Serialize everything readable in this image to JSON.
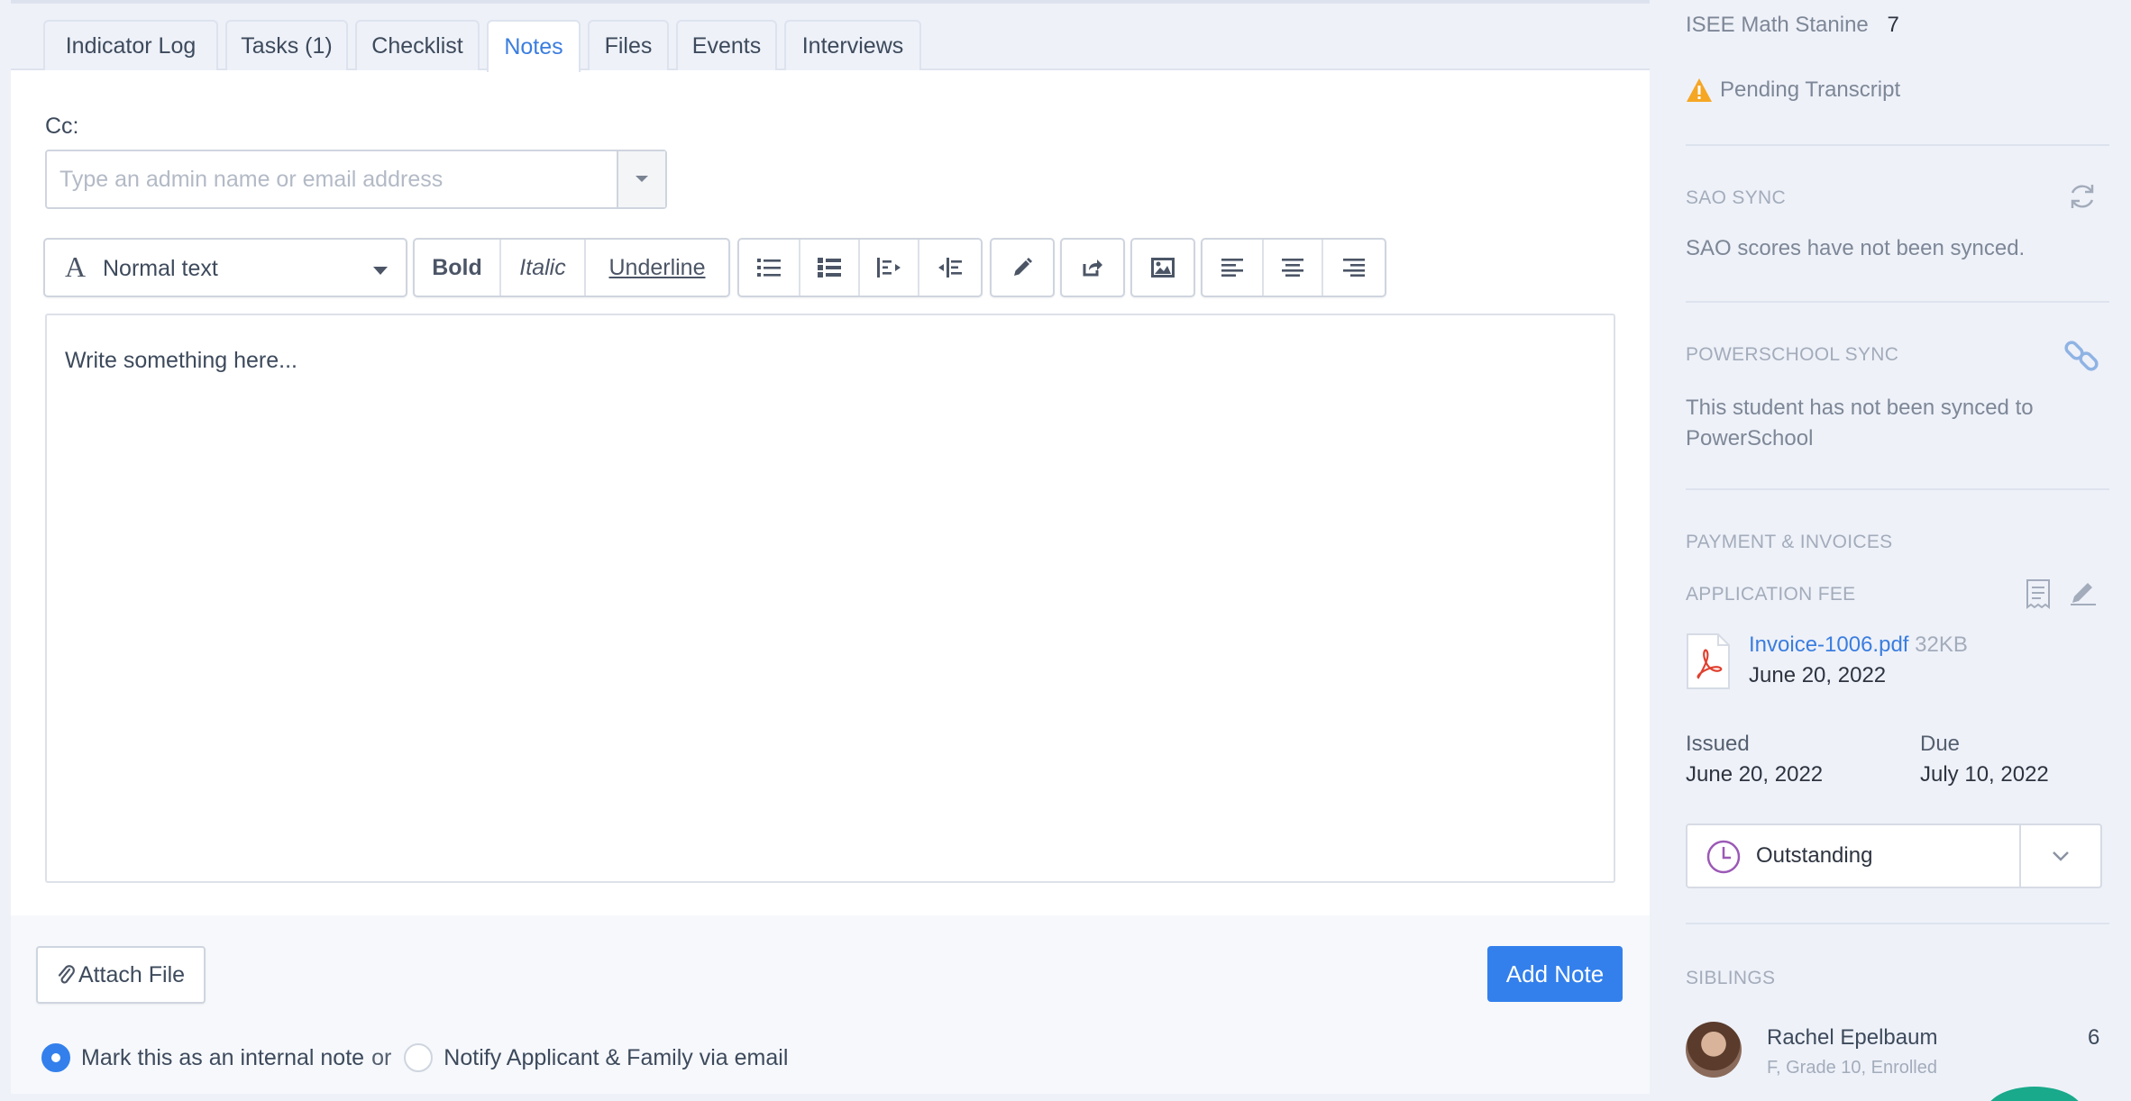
{
  "tabs": [
    {
      "label": "Indicator Log"
    },
    {
      "label": "Tasks (1)"
    },
    {
      "label": "Checklist"
    },
    {
      "label": "Notes"
    },
    {
      "label": "Files"
    },
    {
      "label": "Events"
    },
    {
      "label": "Interviews"
    }
  ],
  "active_tab": "Notes",
  "cc": {
    "label": "Cc:",
    "placeholder": "Type an admin name or email address"
  },
  "toolbar": {
    "format_label": "Normal text",
    "bold": "Bold",
    "italic": "Italic",
    "underline": "Underline"
  },
  "editor": {
    "placeholder": "Write something here..."
  },
  "footer": {
    "attach_label": "Attach File",
    "add_note_label": "Add Note",
    "internal_note_label": "Mark this as an internal note",
    "or_label": "or",
    "notify_label": "Notify Applicant & Family via email"
  },
  "sidebar": {
    "isee_label": "ISEE Math Stanine",
    "isee_value": "7",
    "pending_label": "Pending Transcript",
    "sao_title": "SAO SYNC",
    "sao_text": "SAO scores have not been synced.",
    "ps_title": "POWERSCHOOL SYNC",
    "ps_text_1": "This student has not been synced to",
    "ps_text_2": "PowerSchool",
    "payment_title": "PAYMENT & INVOICES",
    "fee_title": "APPLICATION FEE",
    "invoice_name": "Invoice-1006.pdf",
    "invoice_size": "32KB",
    "invoice_date": "June 20, 2022",
    "issued_label": "Issued",
    "issued_value": "June 20, 2022",
    "due_label": "Due",
    "due_value": "July 10, 2022",
    "status_label": "Outstanding",
    "siblings_title": "SIBLINGS",
    "sibling_name": "Rachel Epelbaum",
    "sibling_meta": "F, Grade 10, Enrolled",
    "sibling_count": "6"
  },
  "colors": {
    "accent": "#3380ec",
    "warning": "#f5a623",
    "pdf_red": "#e0402f",
    "status_purple": "#9b59b6"
  }
}
